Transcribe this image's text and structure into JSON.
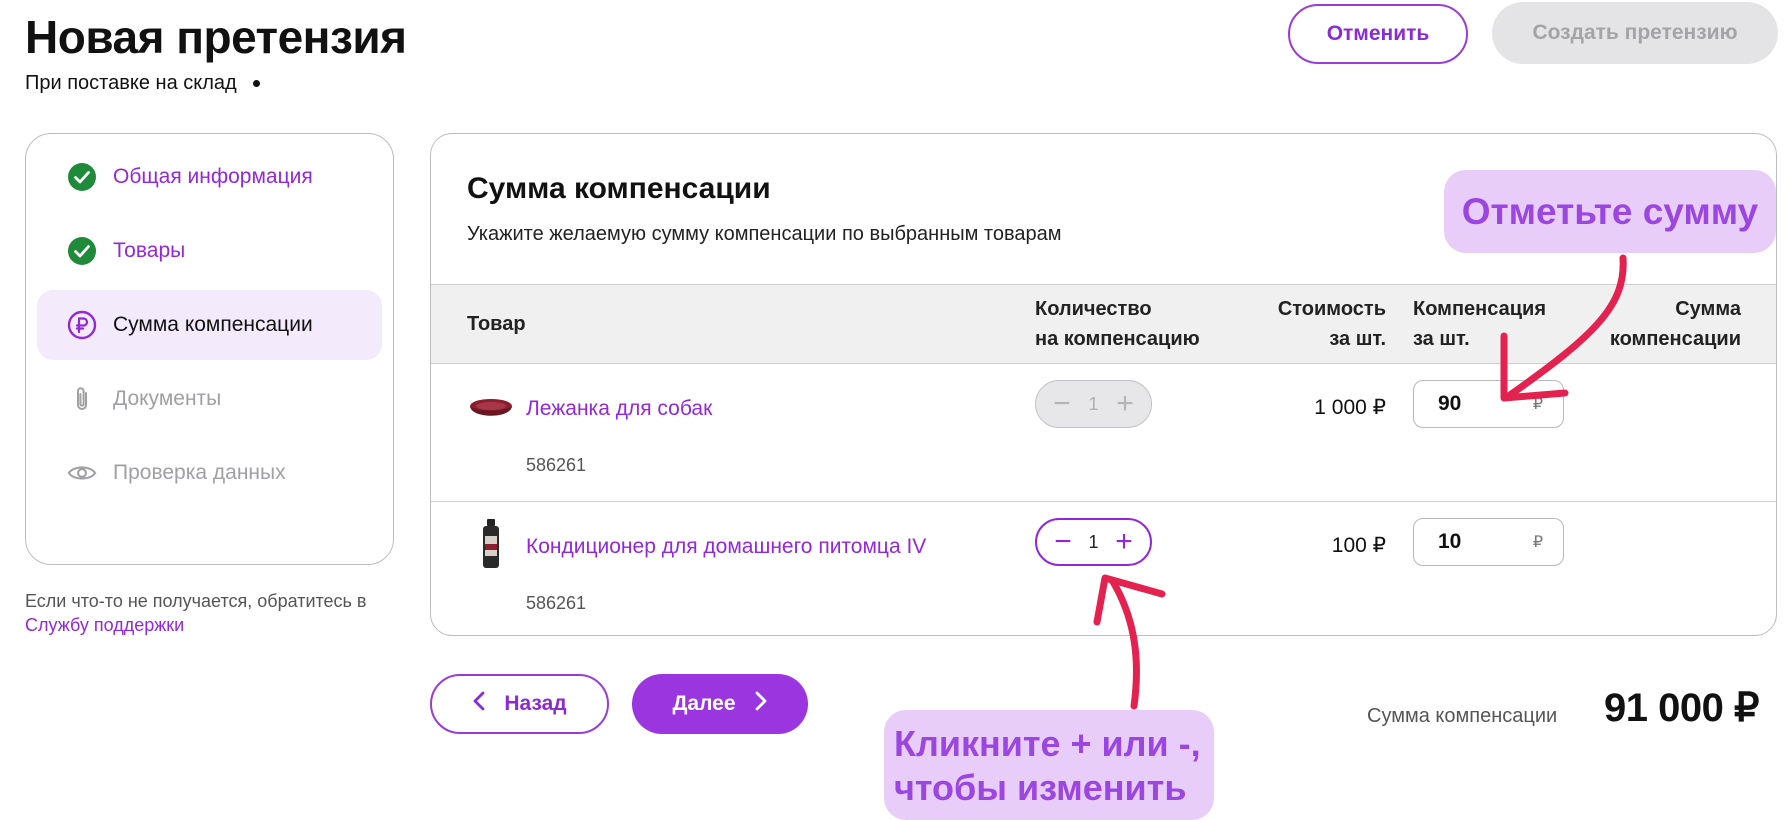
{
  "header": {
    "title": "Новая претензия",
    "subtitle": "При поставке на склад",
    "cancel_label": "Отменить",
    "create_label": "Создать претензию"
  },
  "steps": [
    {
      "label": "Общая информация",
      "state": "done",
      "icon": "check-circle-icon"
    },
    {
      "label": "Товары",
      "state": "done",
      "icon": "check-circle-icon"
    },
    {
      "label": "Сумма компенсации",
      "state": "active",
      "icon": "ruble-circle-icon"
    },
    {
      "label": "Документы",
      "state": "pending",
      "icon": "paperclip-icon"
    },
    {
      "label": "Проверка данных",
      "state": "pending",
      "icon": "eye-icon"
    }
  ],
  "help": {
    "text": "Если что-то не получается, обратитесь в ",
    "link": "Службу поддержки"
  },
  "card": {
    "title": "Сумма компенсации",
    "description": "Укажите желаемую сумму компенсации по выбранным товарам"
  },
  "table": {
    "columns": {
      "product": "Товар",
      "qty_line1": "Количество",
      "qty_line2": "на компенсацию",
      "cost_line1": "Стоимость",
      "cost_line2": "за шт.",
      "comp_line1": "Компенсация",
      "comp_line2": "за шт.",
      "sum_line1": "Сумма",
      "sum_line2": "компенсации"
    },
    "rows": [
      {
        "name": "Лежанка для собак",
        "sku": "586261",
        "qty": "1",
        "stepper_enabled": false,
        "price": "1 000 ₽",
        "compensation": "90",
        "currency": "₽"
      },
      {
        "name": "Кондиционер для домашнего питомца IV",
        "sku": "586261",
        "qty": "1",
        "stepper_enabled": true,
        "price": "100 ₽",
        "compensation": "10",
        "currency": "₽"
      }
    ]
  },
  "footer": {
    "back_label": "Назад",
    "next_label": "Далее",
    "total_label": "Сумма компенсации",
    "total_value": "91 000 ₽"
  },
  "hints": {
    "top": "Отметьте сумму",
    "bottom_line1": "Кликните + или -,",
    "bottom_line2": "чтобы изменить"
  },
  "colors": {
    "accent": "#9427d8",
    "success": "#1e8a3a",
    "hint_bg": "#e8cdf8",
    "arrow": "#e3224f"
  }
}
